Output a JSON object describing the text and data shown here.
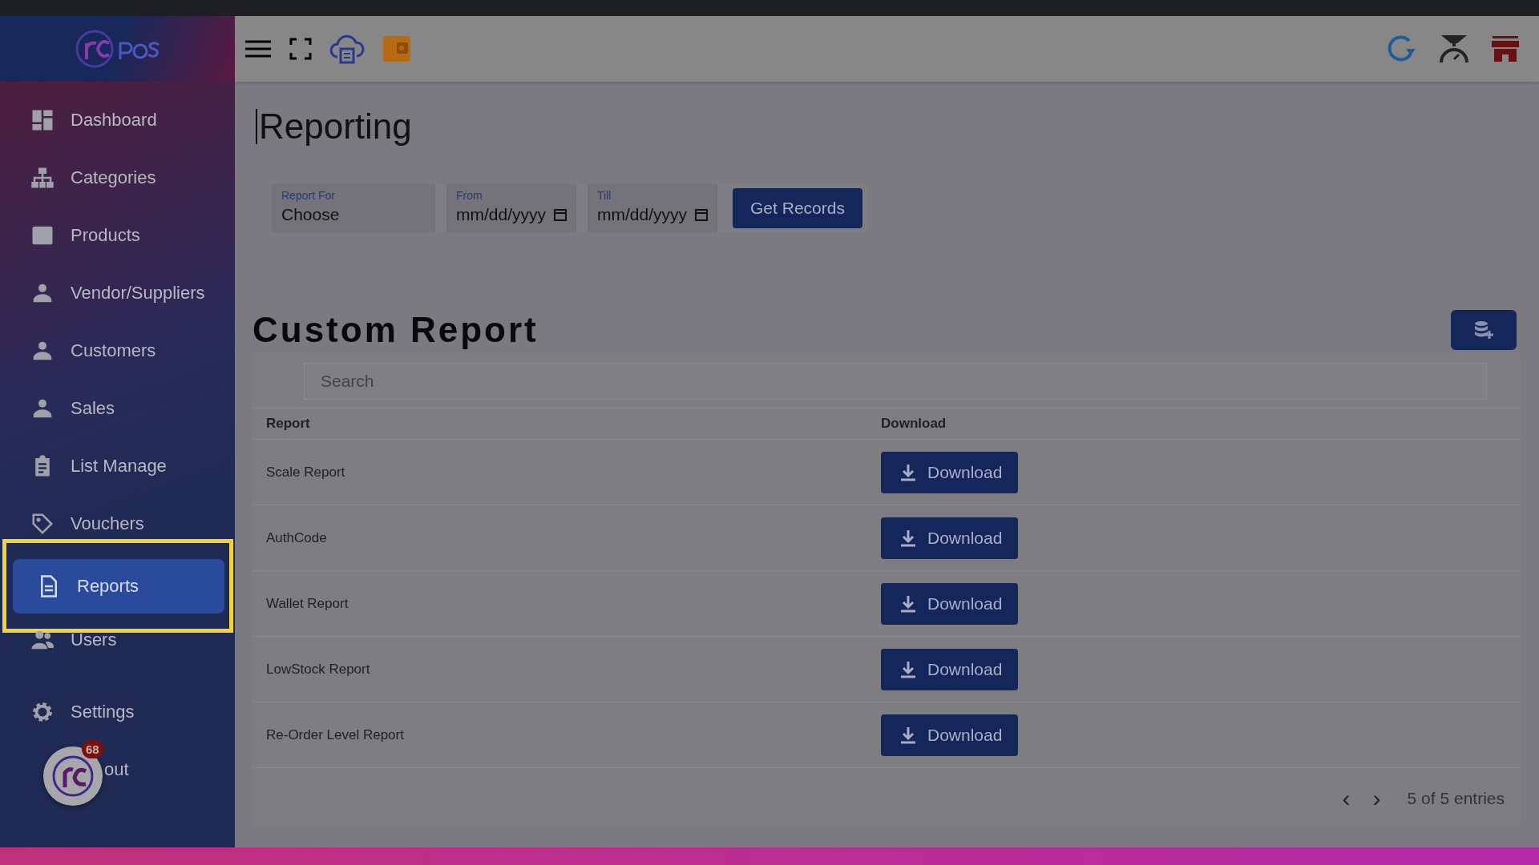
{
  "sidebar": {
    "items": [
      {
        "label": "Dashboard",
        "selected": false
      },
      {
        "label": "Categories",
        "selected": false
      },
      {
        "label": "Products",
        "selected": false
      },
      {
        "label": "Vendor/Suppliers",
        "selected": false
      },
      {
        "label": "Customers",
        "selected": false
      },
      {
        "label": "Sales",
        "selected": false
      },
      {
        "label": "List Manage",
        "selected": false
      },
      {
        "label": "Vouchers",
        "selected": false
      },
      {
        "label": "Reports",
        "selected": true
      },
      {
        "label": "Users",
        "selected": false
      }
    ],
    "bottom_items": [
      {
        "label": "Settings"
      },
      {
        "label": "out"
      }
    ],
    "floating_badge": "68"
  },
  "page_title": "Reporting",
  "filters": [
    {
      "label": "Report For",
      "value": "Choose",
      "kind": "select"
    },
    {
      "label": "From",
      "value": "mm/dd/yyyy",
      "kind": "date"
    },
    {
      "label": "Till",
      "value": "mm/dd/yyyy",
      "kind": "date"
    }
  ],
  "get_button": "Get Records",
  "section_title": "Custom Report",
  "search": {
    "placeholder": "Search"
  },
  "table": {
    "columns": [
      "Report",
      "Download"
    ],
    "rows": [
      {
        "report": "Scale Report",
        "action": "Download"
      },
      {
        "report": "AuthCode",
        "action": "Download"
      },
      {
        "report": "Wallet Report",
        "action": "Download"
      },
      {
        "report": "LowStock Report",
        "action": "Download"
      },
      {
        "report": "Re-Order Level Report",
        "action": "Download"
      }
    ]
  },
  "pagination": {
    "prev": "‹",
    "next": "›",
    "summary": "5 of 5 entries"
  }
}
